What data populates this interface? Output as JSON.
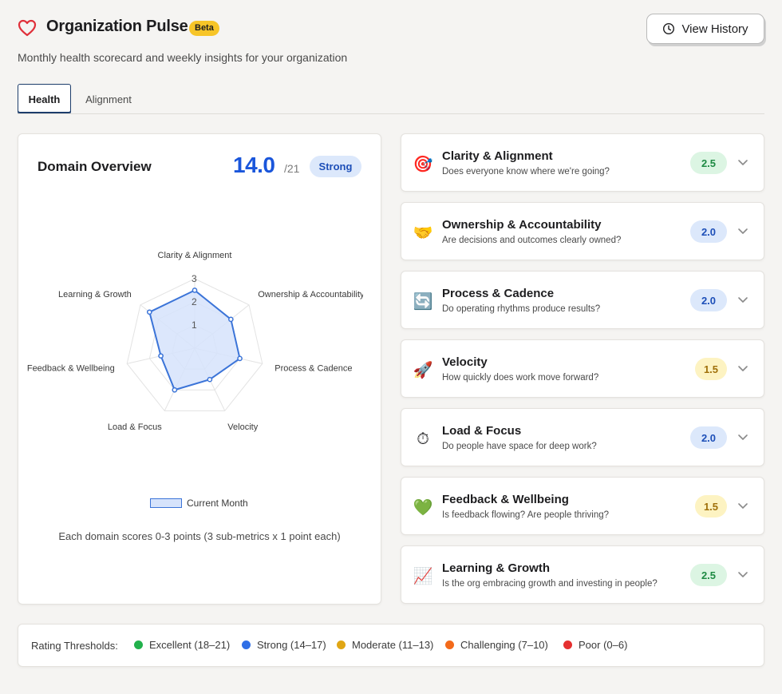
{
  "header": {
    "title": "Organization Pulse",
    "badge": "Beta",
    "subtitle": "Monthly health scorecard and weekly insights for your organization",
    "history_button": "View History",
    "heart_icon": "heart-icon",
    "accent_color": "#e0303a"
  },
  "tabs": [
    {
      "label": "Health",
      "active": true
    },
    {
      "label": "Alignment",
      "active": false
    }
  ],
  "overview": {
    "title": "Domain Overview",
    "score": "14.0",
    "score_max": "/21",
    "status": "Strong",
    "legend_label": "Current Month",
    "note": "Each domain scores 0-3 points (3 sub-metrics x 1 point each)"
  },
  "chart_data": {
    "type": "radar",
    "axes": [
      "Clarity & Alignment",
      "Ownership & Accountability",
      "Process & Cadence",
      "Velocity",
      "Load & Focus",
      "Feedback & Wellbeing",
      "Learning & Growth"
    ],
    "ticks": [
      "1",
      "2",
      "3"
    ],
    "range": [
      0,
      3
    ],
    "series": [
      {
        "name": "Current Month",
        "values": [
          2.5,
          2.0,
          2.0,
          1.5,
          2.0,
          1.5,
          2.5
        ],
        "color": "#3b74d8",
        "fill": "#d6e3fb"
      }
    ],
    "legend": "bottom"
  },
  "domains": [
    {
      "icon": "target-icon",
      "glyph": "🎯",
      "name": "Clarity & Alignment",
      "question": "Does everyone know where we're going?",
      "score": "2.5",
      "level": "excellent"
    },
    {
      "icon": "handshake-icon",
      "glyph": "🤝",
      "name": "Ownership & Accountability",
      "question": "Are decisions and outcomes clearly owned?",
      "score": "2.0",
      "level": "strong"
    },
    {
      "icon": "cycle-icon",
      "glyph": "🔄",
      "name": "Process & Cadence",
      "question": "Do operating rhythms produce results?",
      "score": "2.0",
      "level": "strong"
    },
    {
      "icon": "rocket-icon",
      "glyph": "🚀",
      "name": "Velocity",
      "question": "How quickly does work move forward?",
      "score": "1.5",
      "level": "moderate"
    },
    {
      "icon": "stopwatch-icon",
      "glyph": "⏱",
      "name": "Load & Focus",
      "question": "Do people have space for deep work?",
      "score": "2.0",
      "level": "strong"
    },
    {
      "icon": "green-heart-icon",
      "glyph": "💚",
      "name": "Feedback & Wellbeing",
      "question": "Is feedback flowing? Are people thriving?",
      "score": "1.5",
      "level": "moderate"
    },
    {
      "icon": "chart-increasing-icon",
      "glyph": "📈",
      "name": "Learning & Growth",
      "question": "Is the org embracing growth and investing in people?",
      "score": "2.5",
      "level": "excellent"
    }
  ],
  "score_colors": {
    "excellent": {
      "bg": "#dcf5e3",
      "fg": "#1e8a43"
    },
    "strong": {
      "bg": "#dce8fb",
      "fg": "#1d4fb8"
    },
    "moderate": {
      "bg": "#fdf3c2",
      "fg": "#a0700a"
    }
  },
  "thresholds": {
    "title": "Rating Thresholds:",
    "items": [
      {
        "label": "Excellent (18–21)",
        "color": "#22b14c"
      },
      {
        "label": "Strong (14–17)",
        "color": "#2f6fe6"
      },
      {
        "label": "Moderate (11–13)",
        "color": "#e0a614"
      },
      {
        "label": "Challenging (7–10)",
        "color": "#f36a1a"
      },
      {
        "label": "Poor (0–6)",
        "color": "#e53030"
      }
    ]
  }
}
